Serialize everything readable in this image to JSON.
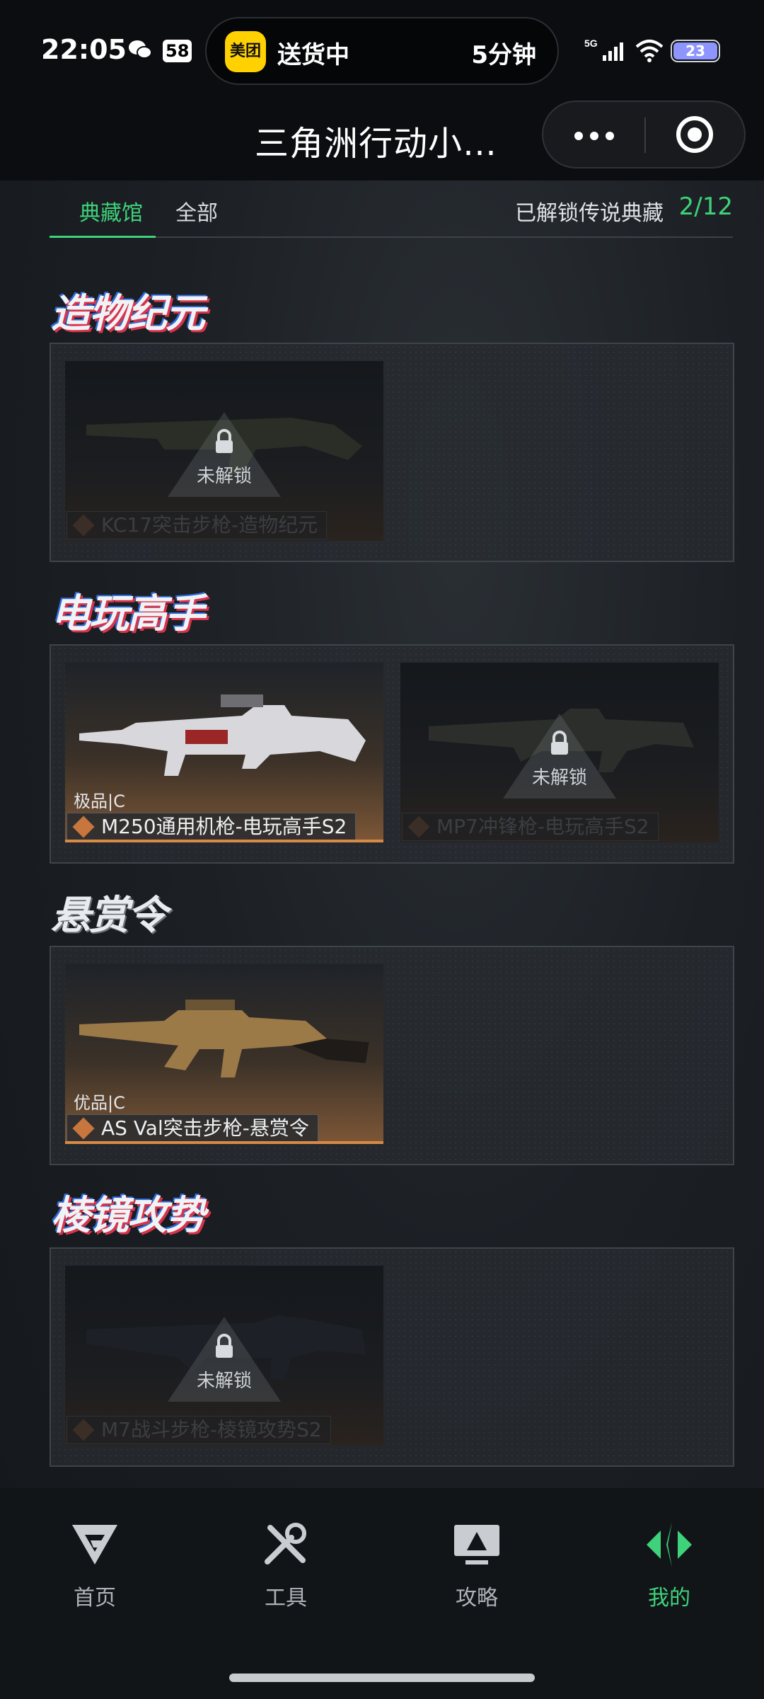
{
  "status_bar": {
    "time": "22:05",
    "notification_count": "58",
    "delivery_app": "美团",
    "delivery_status": "送货中",
    "delivery_eta": "5分钟",
    "network": "5G",
    "battery": "23"
  },
  "title_bar": {
    "title": "三角洲行动小…"
  },
  "tabs": {
    "active": "典藏馆",
    "all": "全部",
    "unlocked_label": "已解锁传说典藏",
    "unlocked_count": "2/12"
  },
  "sections": [
    {
      "logo": "造物纪元",
      "cards": [
        {
          "name": "KC17突击步枪-造物纪元",
          "locked": true,
          "lock_text": "未解锁"
        }
      ]
    },
    {
      "logo": "电玩高手",
      "cards": [
        {
          "name": "M250通用机枪-电玩高手S2",
          "locked": false,
          "rarity": "极品|C"
        },
        {
          "name": "MP7冲锋枪-电玩高手S2",
          "locked": true,
          "lock_text": "未解锁"
        }
      ]
    },
    {
      "logo": "悬赏令",
      "cards": [
        {
          "name": "AS Val突击步枪-悬赏令",
          "locked": false,
          "rarity": "优品|C"
        }
      ]
    },
    {
      "logo": "棱镜攻势",
      "cards": [
        {
          "name": "M7战斗步枪-棱镜攻势S2",
          "locked": true,
          "lock_text": "未解锁"
        }
      ]
    }
  ],
  "bottom_nav": {
    "home": "首页",
    "tools": "工具",
    "guides": "攻略",
    "mine": "我的"
  },
  "colors": {
    "accent": "#3ed27a",
    "rarity_orange": "#d78a45"
  }
}
